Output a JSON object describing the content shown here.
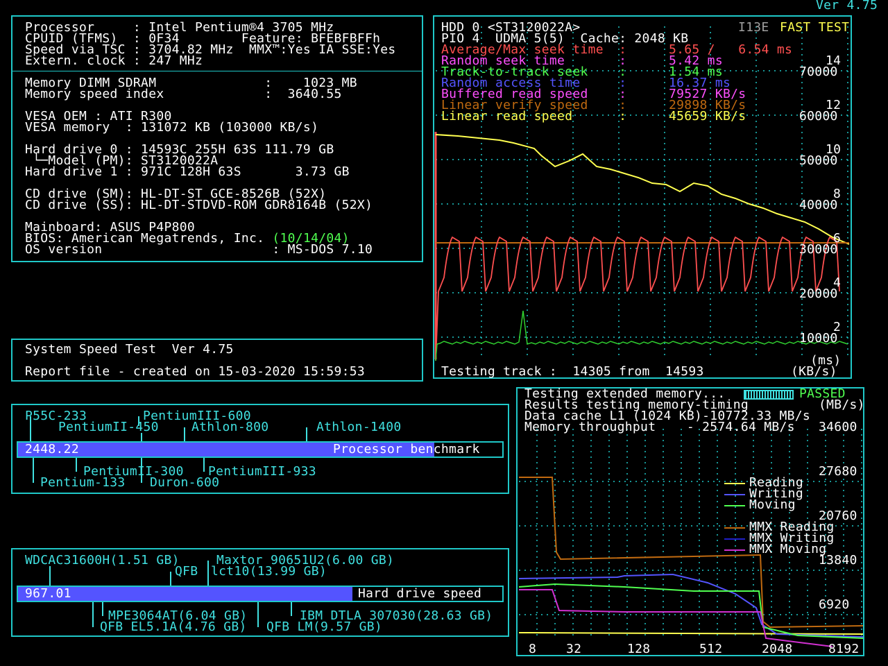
{
  "version": "Ver 4.75",
  "sysinfo": {
    "lines_top": [
      "Processor     : Intel Pentium®4 3705 MHz",
      "CPUID (TFMS)  : 0F34        Feature: BFEBFBFFh",
      "Speed via TSC : 3704.82 MHz  MMX™:Yes IA SSE:Yes",
      "Extern. clock : 247 MHz"
    ],
    "lines_bottom": [
      "Memory DIMM SDRAM              :    1023 MB",
      "Memory speed index             :  3640.55",
      "",
      "VESA OEM : ATI R300",
      "VESA memory  : 131072 KB (103000 KB/s)",
      "",
      "Hard drive 0 : 14593C 255H 63S 111.79 GB",
      " └─Model (PM): ST3120022A",
      "Hard drive 1 : 971C 128H 63S       3.73 GB",
      "",
      "CD drive (SM): HL-DT-ST GCE-8526B (52X)",
      "CD drive (SS): HL-DT-STDVD-ROM GDR8164B (52X)",
      "",
      "Mainboard: ASUS P4P800"
    ],
    "bios_label": "BIOS: American Megatrends, Inc. ",
    "bios_date": "(10/14/04)",
    "os_line": "OS version                      : MS-DOS 7.10"
  },
  "report": {
    "line1": "System Speed Test  Ver 4.75",
    "line2": "Report file - created on 15-03-2020 15:59:53"
  },
  "hdd": {
    "title": "HDD 0 <ST3120022A>",
    "badge": "I13E",
    "fast_test": "FAST TEST",
    "line2": "PIO 4  UDMA 5(5)  Cache: 2048 KB",
    "stats": [
      {
        "label": "Average/Max seek time  :",
        "value": "5.65 /   6.54 ms",
        "color": "#ff5050"
      },
      {
        "label": "Random seek time       :",
        "value": "5.42 ms",
        "color": "#ff50ff"
      },
      {
        "label": "Track-to-track seek    :",
        "value": "1.54 ms",
        "color": "#50ff50"
      },
      {
        "label": "Random access time     :",
        "value": "16.37 ms",
        "color": "#5454ff"
      },
      {
        "label": "Buffered read speed    :",
        "value": "79527 KB/s",
        "color": "#ff50ff"
      },
      {
        "label": "Linear verify speed    :",
        "value": "29898 KB/s",
        "color": "#c06a10"
      },
      {
        "label": "Linear read speed      :",
        "value": "45659 KB/s",
        "color": "#ffff50"
      }
    ],
    "ms_ticks": [
      "14",
      "12",
      "10",
      "8",
      "6",
      "4",
      "2"
    ],
    "kb_ticks": [
      "70000",
      "60000",
      "50000",
      "40000",
      "30000",
      "20000",
      "10000"
    ],
    "unit_ms": "(ms)",
    "unit_kb": "(KB/s)",
    "testing_track": "Testing track :  14305 from  14593"
  },
  "memory": {
    "line1": "Testing extended memory...",
    "passed": "PASSED",
    "line2": "Results testing memory-timing",
    "unit": "(MB/s)",
    "line3": "Data cache L1 (1024 KB)-10772.33 MB/s",
    "line4": "Memory throughput    - 2574.64 MB/s",
    "y_ticks": [
      "34600",
      "27680",
      "20760",
      "13840",
      "6920"
    ],
    "x_ticks": [
      "8",
      "32",
      "128",
      "512",
      "2048",
      "8192"
    ],
    "legend": [
      {
        "name": "Reading",
        "color": "#ffff50"
      },
      {
        "name": "Writing",
        "color": "#5454ff"
      },
      {
        "name": "Moving",
        "color": "#50ff50"
      },
      {
        "name": "MMX Reading",
        "color": "#c06a10"
      },
      {
        "name": "MMX Writing",
        "color": "#2020c8"
      },
      {
        "name": "MMX Moving",
        "color": "#d030d0"
      }
    ]
  },
  "cpu_bench": {
    "value_label": "2448.22",
    "fill_fraction": 0.86,
    "title": "Processor benchmark",
    "refs_top": [
      "P55C-233",
      "PentiumII-450",
      "PentiumIII-600",
      "Athlon-800",
      "Athlon-1400"
    ],
    "refs_bottom": [
      "PentiumII-300",
      "PentiumIII-933",
      "Pentium-133",
      "Duron-600"
    ]
  },
  "hdd_bench": {
    "value_label": "967.01",
    "fill_fraction": 0.69,
    "title": "Hard drive speed",
    "refs_top": [
      "WDCAC31600H(1.51 GB)",
      "Maxtor 90651U2(6.00 GB)",
      "QFB",
      "lct10(13.99 GB)"
    ],
    "refs_bottom": [
      "MPE3064AT(6.04 GB)",
      "IBM DTLA 307030(28.63 GB)",
      "QFB EL5.1A(4.76 GB)",
      "QFB LM(9.57 GB)"
    ]
  }
}
